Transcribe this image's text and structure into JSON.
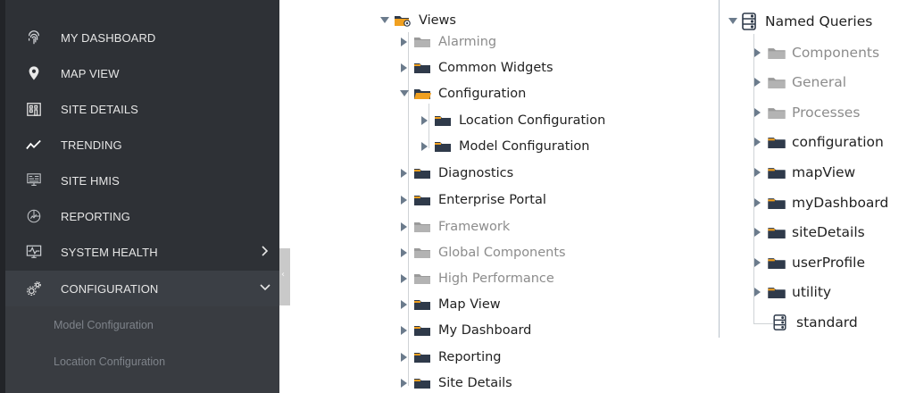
{
  "sidebar": {
    "items": [
      {
        "label": "MY DASHBOARD",
        "icon": "fingerprint-icon"
      },
      {
        "label": "MAP VIEW",
        "icon": "map-pin-icon"
      },
      {
        "label": "SITE DETAILS",
        "icon": "building-icon"
      },
      {
        "label": "TRENDING",
        "icon": "trend-line-icon"
      },
      {
        "label": "SITE HMIS",
        "icon": "hmi-monitor-icon"
      },
      {
        "label": "REPORTING",
        "icon": "report-chart-icon"
      },
      {
        "label": "SYSTEM HEALTH",
        "icon": "health-monitor-icon"
      },
      {
        "label": "CONFIGURATION",
        "icon": "gears-icon"
      }
    ],
    "subitems": [
      "Model Configuration",
      "Location Configuration"
    ],
    "collapse_glyph": "‹"
  },
  "views_tree": {
    "root": "Views",
    "items": [
      {
        "label": "Alarming"
      },
      {
        "label": "Common Widgets"
      },
      {
        "label": "Configuration"
      },
      {
        "label": "Location Configuration"
      },
      {
        "label": "Model Configuration"
      },
      {
        "label": "Diagnostics"
      },
      {
        "label": "Enterprise Portal"
      },
      {
        "label": "Framework"
      },
      {
        "label": "Global Components"
      },
      {
        "label": "High Performance"
      },
      {
        "label": "Map View"
      },
      {
        "label": "My Dashboard"
      },
      {
        "label": "Reporting"
      },
      {
        "label": "Site Details"
      }
    ]
  },
  "queries_tree": {
    "root": "Named Queries",
    "items": [
      {
        "label": "Components"
      },
      {
        "label": "General"
      },
      {
        "label": "Processes"
      },
      {
        "label": "configuration"
      },
      {
        "label": "mapView"
      },
      {
        "label": "myDashboard"
      },
      {
        "label": "siteDetails"
      },
      {
        "label": "userProfile"
      },
      {
        "label": "utility"
      },
      {
        "label": "standard"
      }
    ]
  },
  "colors": {
    "folder": "#2f3a4a",
    "folder_accent": "#f0a020",
    "folder_muted": "#9a9a9a",
    "sidebar_bg": "#2e3136"
  }
}
